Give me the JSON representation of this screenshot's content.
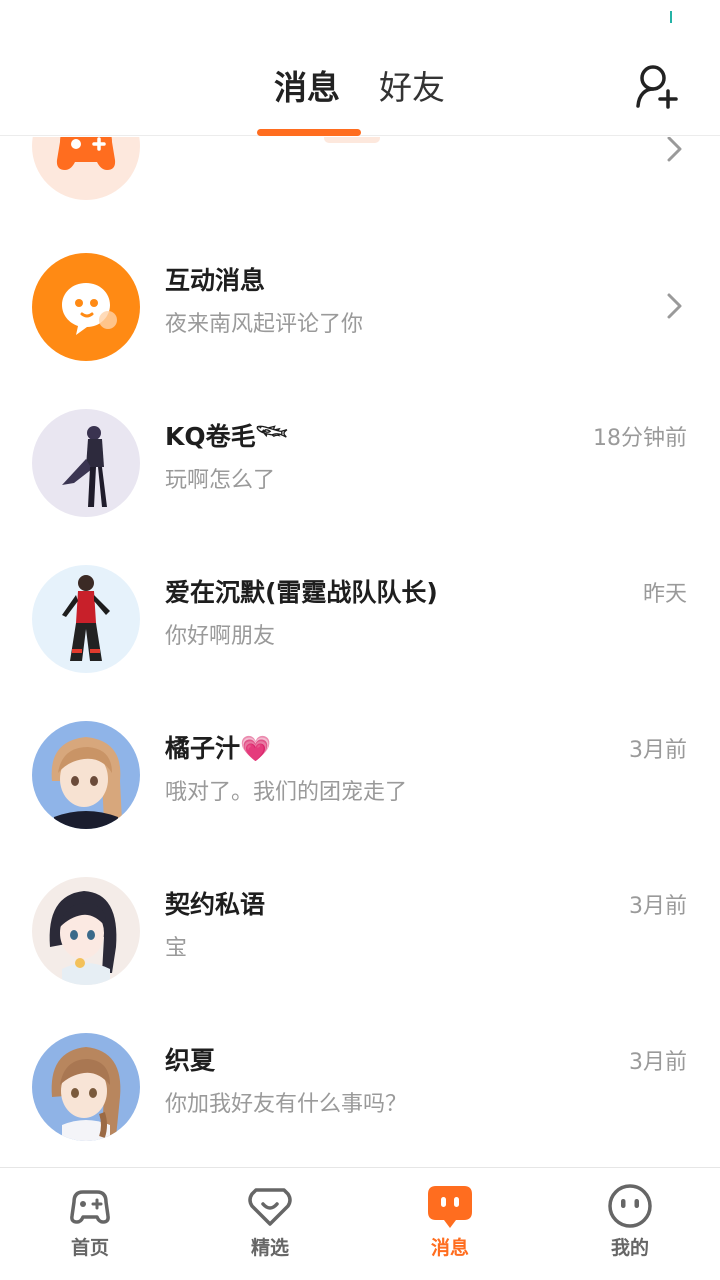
{
  "header": {
    "tabs": [
      {
        "label": "消息"
      },
      {
        "label": "好友"
      }
    ]
  },
  "messages": [
    {
      "title": "",
      "subtitle": "",
      "time": "",
      "avatar": "game-controller-icon"
    },
    {
      "title": "互动消息",
      "subtitle": "夜来南风起评论了你",
      "time": "",
      "avatar": "chat-bubble-icon"
    },
    {
      "title": "KQ卷毛𓆝",
      "subtitle": "玩啊怎么了",
      "time": "18分钟前",
      "avatar": "user-avatar"
    },
    {
      "title": "爱在沉默(雷霆战队队长)",
      "subtitle": "你好啊朋友",
      "time": "昨天",
      "avatar": "user-avatar"
    },
    {
      "title": "橘子汁💗",
      "subtitle": "哦对了。我们的团宠走了",
      "time": "3月前",
      "avatar": "user-avatar"
    },
    {
      "title": "契约私语",
      "subtitle": "宝",
      "time": "3月前",
      "avatar": "user-avatar"
    },
    {
      "title": "织夏",
      "subtitle": "你加我好友有什么事吗？",
      "time": "3月前",
      "avatar": "user-avatar"
    }
  ],
  "nav": [
    {
      "label": "首页",
      "icon": "gamepad-icon"
    },
    {
      "label": "精选",
      "icon": "heart-icon"
    },
    {
      "label": "消息",
      "icon": "message-icon"
    },
    {
      "label": "我的",
      "icon": "smiley-icon"
    }
  ],
  "colors": {
    "accent": "#ff6d1f",
    "muted": "#9a9a9a"
  }
}
